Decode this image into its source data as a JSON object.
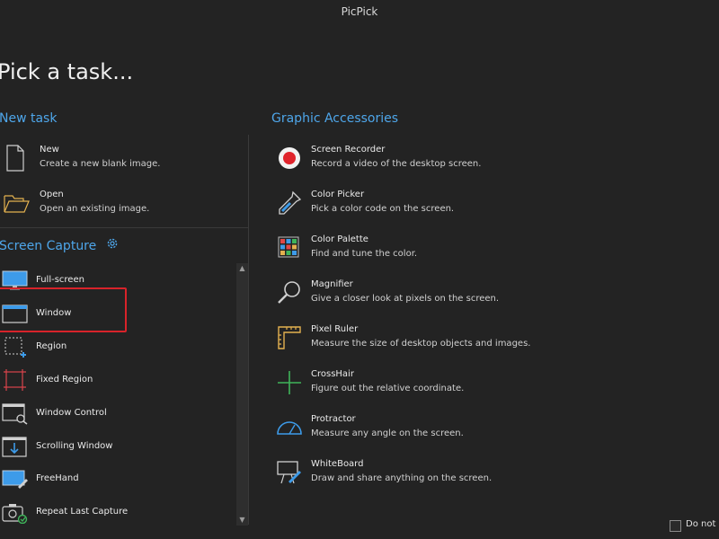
{
  "window": {
    "title": "PicPick"
  },
  "page": {
    "title": "Pick a task..."
  },
  "new_task": {
    "heading": "New task",
    "items": [
      {
        "name": "New",
        "desc": "Create a new blank image.",
        "icon": "new-file-icon"
      },
      {
        "name": "Open",
        "desc": "Open an existing image.",
        "icon": "open-folder-icon"
      }
    ]
  },
  "screen_capture": {
    "heading": "Screen Capture",
    "settings_icon": "gear-icon",
    "selected": "Window",
    "items": [
      {
        "name": "Full-screen",
        "icon": "monitor-icon"
      },
      {
        "name": "Window",
        "icon": "window-icon"
      },
      {
        "name": "Region",
        "icon": "region-icon"
      },
      {
        "name": "Fixed Region",
        "icon": "fixed-region-icon"
      },
      {
        "name": "Window Control",
        "icon": "window-control-icon"
      },
      {
        "name": "Scrolling Window",
        "icon": "scrolling-window-icon"
      },
      {
        "name": "FreeHand",
        "icon": "freehand-icon"
      },
      {
        "name": "Repeat Last Capture",
        "icon": "repeat-capture-icon"
      }
    ]
  },
  "graphic_accessories": {
    "heading": "Graphic Accessories",
    "items": [
      {
        "name": "Screen Recorder",
        "desc": "Record a video of the desktop screen.",
        "icon": "record-icon"
      },
      {
        "name": "Color Picker",
        "desc": "Pick a color code on the screen.",
        "icon": "eyedropper-icon"
      },
      {
        "name": "Color Palette",
        "desc": "Find and tune the color.",
        "icon": "palette-icon"
      },
      {
        "name": "Magnifier",
        "desc": "Give a closer look at pixels on the screen.",
        "icon": "magnifier-icon"
      },
      {
        "name": "Pixel Ruler",
        "desc": "Measure the size of desktop objects and images.",
        "icon": "ruler-icon"
      },
      {
        "name": "CrossHair",
        "desc": "Figure out the relative coordinate.",
        "icon": "crosshair-icon"
      },
      {
        "name": "Protractor",
        "desc": "Measure any angle on the screen.",
        "icon": "protractor-icon"
      },
      {
        "name": "WhiteBoard",
        "desc": "Draw and share anything on the screen.",
        "icon": "whiteboard-icon"
      }
    ]
  },
  "footer": {
    "dont_show_label": "Do not s"
  },
  "colors": {
    "accent": "#4ea6ea",
    "background": "#232323",
    "selection": "#d8232a"
  }
}
